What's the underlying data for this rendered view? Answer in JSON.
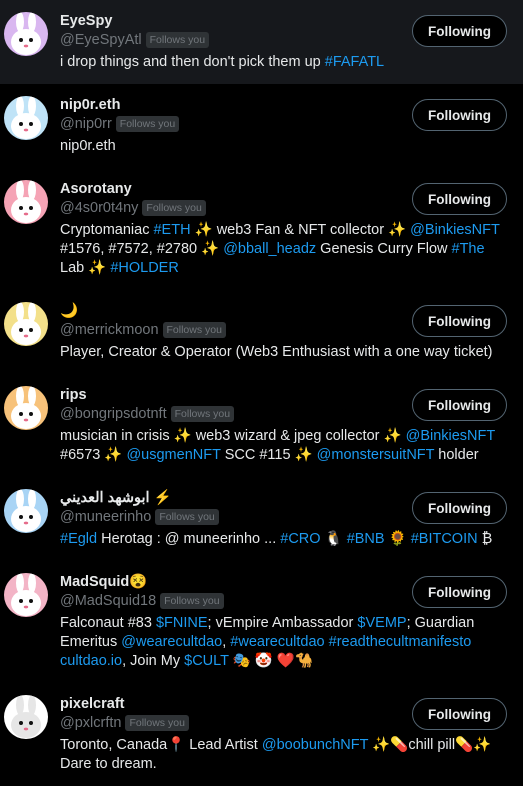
{
  "follow_button_label": "Following",
  "follows_you_badge": "Follows you",
  "users": [
    {
      "name": "EyeSpy",
      "handle": "@EyeSpyAtl",
      "bio": [
        {
          "t": "i drop things and then don't pick them up "
        },
        {
          "t": "#FAFATL",
          "link": true
        }
      ],
      "highlight": true,
      "avatar": {
        "bg": "#d9b7f0",
        "face": "#ffffff",
        "icon": "bunny-avatar-icon"
      }
    },
    {
      "name": "nip0r.eth",
      "handle": "@nip0rr",
      "bio": [
        {
          "t": "nip0r.eth"
        }
      ],
      "highlight": false,
      "avatar": {
        "bg": "#bfe3f7",
        "face": "#ffffff",
        "icon": "bunny-avatar-icon"
      }
    },
    {
      "name": "Asorotany",
      "handle": "@4s0r0t4ny",
      "bio": [
        {
          "t": "Cryptomaniac "
        },
        {
          "t": "#ETH",
          "link": true
        },
        {
          "t": " ✨ ",
          "spark": true
        },
        {
          "t": "web3 Fan & NFT collector "
        },
        {
          "t": "✨ ",
          "spark": true
        },
        {
          "t": "@BinkiesNFT",
          "link": true
        },
        {
          "t": " #1576, #7572, #2780 "
        },
        {
          "t": "✨ ",
          "spark": true
        },
        {
          "t": "@bball_headz",
          "link": true
        },
        {
          "t": " Genesis Curry Flow "
        },
        {
          "t": "#The",
          "link": true
        },
        {
          "t": " Lab "
        },
        {
          "t": "✨ ",
          "spark": true
        },
        {
          "t": "#HOLDER",
          "link": true
        }
      ],
      "highlight": false,
      "avatar": {
        "bg": "#f5a3b5",
        "face": "#ffffff",
        "icon": "bunny-avatar-icon"
      }
    },
    {
      "name": "🌙",
      "handle": "@merrickmoon",
      "bio": [
        {
          "t": "Player, Creator & Operator (Web3 Enthusiast with a one way ticket)"
        }
      ],
      "highlight": false,
      "avatar": {
        "bg": "#f3e08a",
        "face": "#ffffff",
        "icon": "bunny-avatar-icon"
      }
    },
    {
      "name": "rips",
      "handle": "@bongripsdotnft",
      "bio": [
        {
          "t": "musician in crisis "
        },
        {
          "t": "✨ ",
          "spark": true
        },
        {
          "t": "web3 wizard & jpeg collector "
        },
        {
          "t": "✨ ",
          "spark": true
        },
        {
          "t": "@BinkiesNFT",
          "link": true
        },
        {
          "t": " #6573 "
        },
        {
          "t": "✨ ",
          "spark": true
        },
        {
          "t": "@usgmenNFT",
          "link": true
        },
        {
          "t": " SCC #115 "
        },
        {
          "t": "✨ ",
          "spark": true
        },
        {
          "t": "@monstersuitNFT",
          "link": true
        },
        {
          "t": " holder"
        }
      ],
      "highlight": false,
      "avatar": {
        "bg": "#f7c27a",
        "face": "#ffffff",
        "icon": "bunny-avatar-icon"
      }
    },
    {
      "name": "ابوشهد العديني ⚡",
      "handle": "@muneerinho",
      "bio": [
        {
          "t": "#Egld",
          "link": true
        },
        {
          "t": " Herotag : @ muneerinho ... "
        },
        {
          "t": "#CRO",
          "link": true
        },
        {
          "t": " 🐧 "
        },
        {
          "t": "#BNB",
          "link": true
        },
        {
          "t": " 🌻 "
        },
        {
          "t": "#BITCOIN",
          "link": true
        },
        {
          "t": " ₿"
        }
      ],
      "highlight": false,
      "avatar": {
        "bg": "#a8d4f5",
        "face": "#ffffff",
        "icon": "bunny-avatar-icon"
      }
    },
    {
      "name": "MadSquid😵",
      "handle": "@MadSquid18",
      "bio": [
        {
          "t": "Falconaut #83 "
        },
        {
          "t": "$FNINE",
          "link": true
        },
        {
          "t": "; vEmpire Ambassador "
        },
        {
          "t": "$VEMP",
          "link": true
        },
        {
          "t": "; Guardian Emeritus "
        },
        {
          "t": "@wearecultdao",
          "link": true
        },
        {
          "t": ", "
        },
        {
          "t": "#wearecultdao",
          "link": true
        },
        {
          "t": " "
        },
        {
          "t": "#readthecultmanifesto",
          "link": true
        },
        {
          "t": " "
        },
        {
          "t": "cultdao.io",
          "link": true
        },
        {
          "t": ", Join My "
        },
        {
          "t": "$CULT",
          "link": true
        },
        {
          "t": " 🎭 🤡 ❤️🐪"
        }
      ],
      "highlight": false,
      "avatar": {
        "bg": "#f3b4c6",
        "face": "#ffffff",
        "icon": "bunny-avatar-icon"
      }
    },
    {
      "name": "pixelcraft",
      "handle": "@pxlcrftn",
      "bio": [
        {
          "t": "Toronto, Canada📍 Lead Artist "
        },
        {
          "t": "@boobunchNFT",
          "link": true
        },
        {
          "t": " ✨💊chill pill💊✨ Dare to dream."
        }
      ],
      "highlight": false,
      "avatar": {
        "bg": "#ffffff",
        "face": "#e6e6e6",
        "icon": "ghost-avatar-icon"
      }
    }
  ]
}
